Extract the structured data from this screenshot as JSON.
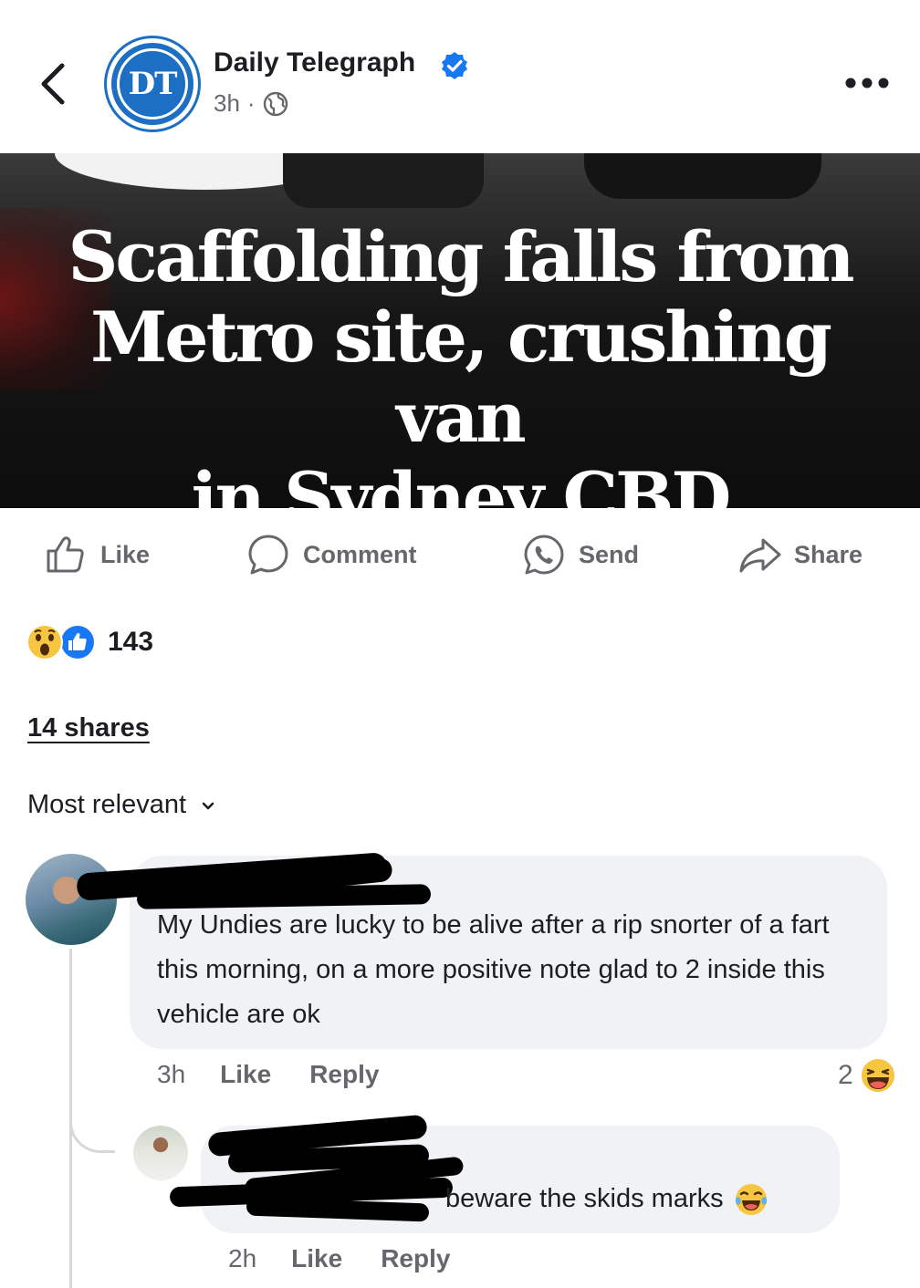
{
  "post": {
    "page_name": "Daily Telegraph",
    "avatar_initials": "DT",
    "time": "3h",
    "separator": "·",
    "headline_line1": "Scaffolding falls from",
    "headline_line2": "Metro site, crushing van",
    "headline_line3": "in Sydney CBD"
  },
  "actions": {
    "like": "Like",
    "comment": "Comment",
    "send": "Send",
    "share": "Share"
  },
  "stats": {
    "reaction_count": "143",
    "shares": "14 shares"
  },
  "sort": {
    "label": "Most relevant"
  },
  "comments": [
    {
      "text": "My Undies are lucky to be alive after a rip snorter of a fart this morning, on a more positive note glad to 2 inside this vehicle are ok",
      "time": "3h",
      "like": "Like",
      "reply": "Reply",
      "reaction_count": "2"
    },
    {
      "text": "beware the skids marks",
      "time": "2h",
      "like": "Like",
      "reply": "Reply"
    }
  ],
  "colors": {
    "brand_blue": "#1d6fc4",
    "verified_blue": "#1877f2",
    "muted_text": "#65676b",
    "bubble_bg": "#f0f2f5"
  }
}
